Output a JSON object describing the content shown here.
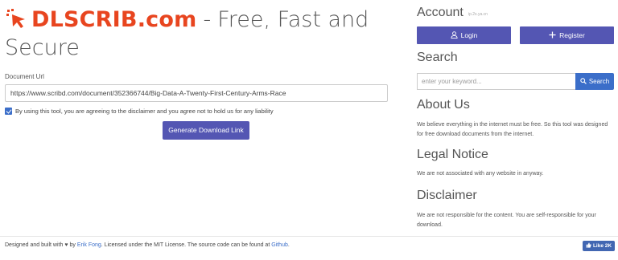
{
  "brand": {
    "logo_text": "DLSCRIB.com",
    "separator": "-",
    "tagline_line1": "Free, Fast and",
    "tagline_line2": "Secure",
    "color": "#e8451f"
  },
  "form": {
    "label": "Document Url",
    "url_value": "https://www.scribd.com/document/352366744/Big-Data-A-Twenty-First-Century-Arms-Race",
    "agree_checked": true,
    "agree_text": "By using this tool, you are agreeing to the disclaimer and you agree not to hold us for any liability",
    "submit_label": "Generate Download Link"
  },
  "sidebar": {
    "account_title": "Account",
    "account_sub": "ip.2s.ya.cn",
    "login_label": "Login",
    "register_label": "Register",
    "search_title": "Search",
    "search_placeholder": "enter your keyword...",
    "search_button": "Search",
    "about_title": "About Us",
    "about_text": "We believe everything in the internet must be free. So this tool was designed for free download documents from the internet.",
    "legal_title": "Legal Notice",
    "legal_text": "We are not associated with any website in anyway.",
    "disclaimer_title": "Disclaimer",
    "disclaimer_text": "We are not responsible for the content. You are self-responsible for your download."
  },
  "footer": {
    "text_1": "Designed and built with",
    "text_2": "by",
    "author": "Erik Fong",
    "text_3": ". Licensed under the MIT License. The source code can be found at",
    "github": "Github",
    "text_4": ".",
    "like_label": "Like 2K"
  },
  "colors": {
    "primary": "#5456b3",
    "link": "#3b6ec9"
  },
  "icons": {
    "logo": "cursor-pointer-icon",
    "login": "user-icon",
    "register": "plus-icon",
    "search": "search-icon",
    "heart": "heart-icon",
    "like": "thumbs-up-icon"
  }
}
